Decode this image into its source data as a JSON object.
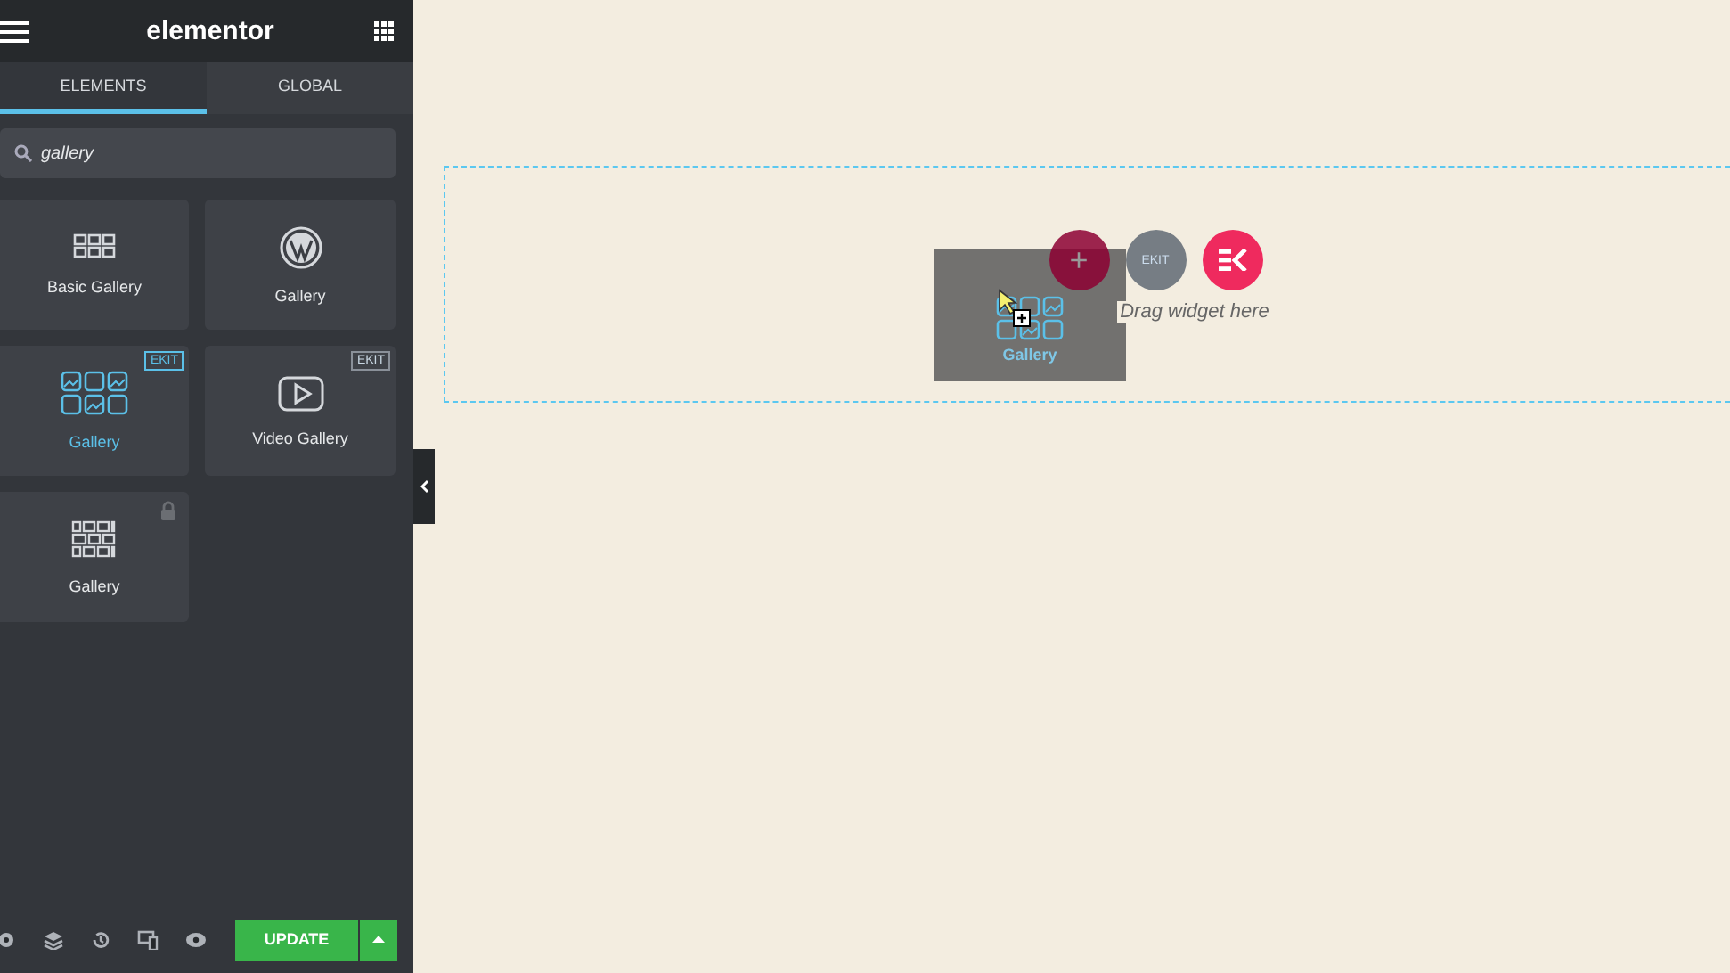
{
  "header": {
    "logo": "elementor"
  },
  "tabs": [
    {
      "label": "ELEMENTS",
      "selected": true
    },
    {
      "label": "GLOBAL",
      "selected": false
    }
  ],
  "search": {
    "value": "gallery"
  },
  "widgets": [
    {
      "label": "Basic Gallery",
      "kind": "grid",
      "selected": false
    },
    {
      "label": "Gallery",
      "kind": "wordpress",
      "selected": false
    },
    {
      "label": "Gallery",
      "kind": "image-grid",
      "selected": true,
      "badge": "EKIT"
    },
    {
      "label": "Video Gallery",
      "kind": "video",
      "selected": false,
      "badge": "EKIT"
    },
    {
      "label": "Gallery",
      "kind": "brick-grid",
      "selected": false,
      "locked": true
    }
  ],
  "footer": {
    "update_button": "UPDATE"
  },
  "canvas": {
    "add_button": "+",
    "template_badge": "EKIT",
    "drop_hint": "Drag widget here",
    "drag_preview": "Gallery"
  }
}
